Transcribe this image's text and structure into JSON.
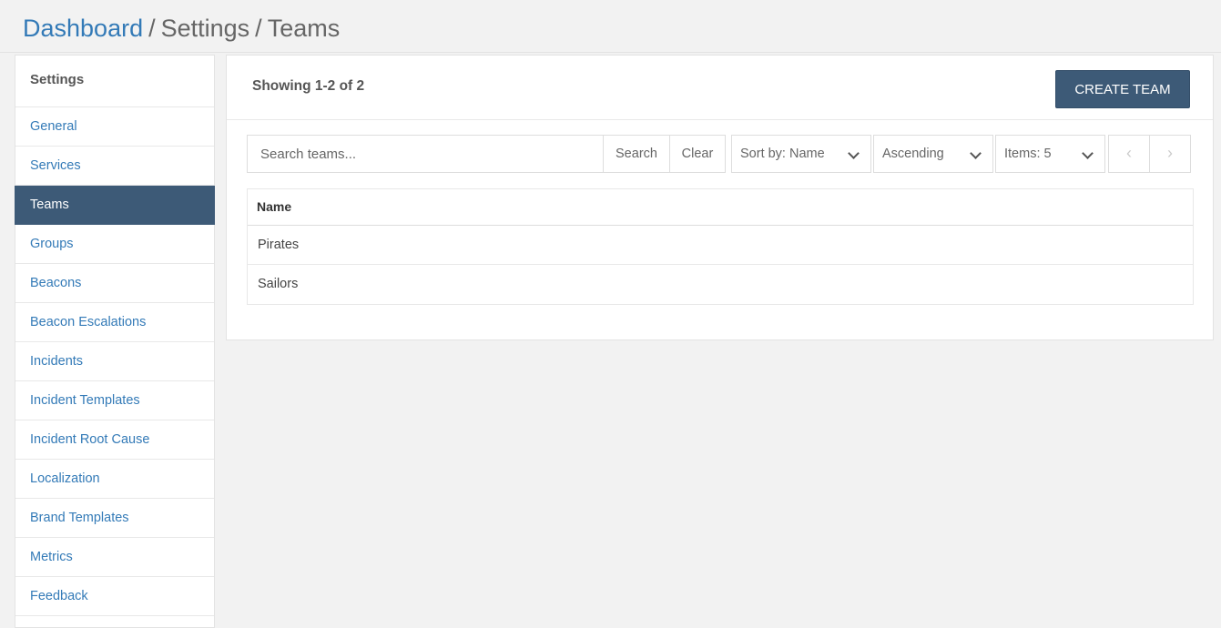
{
  "breadcrumb": {
    "home": "Dashboard",
    "sep1": "/",
    "section": "Settings",
    "sep2": "/",
    "current": "Teams"
  },
  "sidebar": {
    "header": "Settings",
    "items": [
      {
        "label": "General"
      },
      {
        "label": "Services"
      },
      {
        "label": "Teams",
        "active": true
      },
      {
        "label": "Groups"
      },
      {
        "label": "Beacons"
      },
      {
        "label": "Beacon Escalations"
      },
      {
        "label": "Incidents"
      },
      {
        "label": "Incident Templates"
      },
      {
        "label": "Incident Root Cause"
      },
      {
        "label": "Localization"
      },
      {
        "label": "Brand Templates"
      },
      {
        "label": "Metrics"
      },
      {
        "label": "Feedback"
      }
    ]
  },
  "panel": {
    "showing": "Showing 1-2 of 2",
    "create_label": "CREATE TEAM"
  },
  "toolbar": {
    "search_placeholder": "Search teams...",
    "search_label": "Search",
    "clear_label": "Clear",
    "sort": "Sort by: Name",
    "order": "Ascending",
    "items": "Items: 5",
    "prev": "‹",
    "next": "›"
  },
  "table": {
    "header": "Name",
    "rows": [
      "Pirates",
      "Sailors"
    ]
  },
  "colors": {
    "accent": "#3d5a77",
    "link": "#337ab7"
  }
}
